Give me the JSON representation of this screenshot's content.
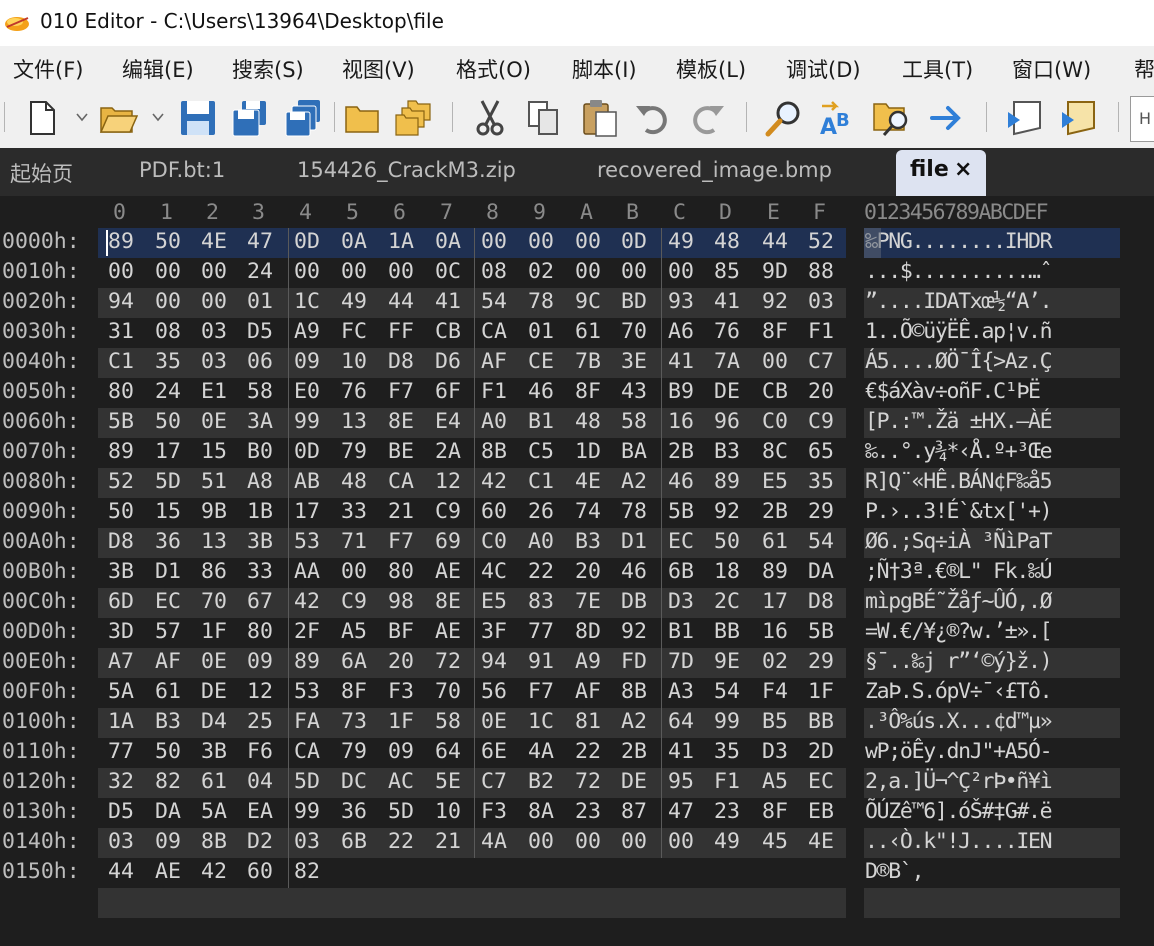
{
  "window": {
    "title": "010 Editor - C:\\Users\\13964\\Desktop\\file"
  },
  "menu": [
    "文件(F)",
    "编辑(E)",
    "搜索(S)",
    "视图(V)",
    "格式(O)",
    "脚本(I)",
    "模板(L)",
    "调试(D)",
    "工具(T)",
    "窗口(W)",
    "帮"
  ],
  "toolbar": {
    "icons": [
      "new-file-icon",
      "open-folder-icon",
      "save-icon",
      "save-as-icon",
      "save-all-icon",
      "folder-icon",
      "open-workspace-icon",
      "cut-icon",
      "copy-icon",
      "paste-icon",
      "undo-icon",
      "redo-icon",
      "find-icon",
      "replace-icon",
      "find-in-files-icon",
      "goto-icon",
      "run-script-icon",
      "run-template-icon"
    ],
    "overflow_label": "H"
  },
  "tabs": [
    "起始页",
    "PDF.bt:1",
    "154426_CrackM3.zip",
    "recovered_image.bmp",
    "file"
  ],
  "active_tab": {
    "label": "file",
    "close": "×"
  },
  "hex": {
    "columns": [
      "0",
      "1",
      "2",
      "3",
      "4",
      "5",
      "6",
      "7",
      "8",
      "9",
      "A",
      "B",
      "C",
      "D",
      "E",
      "F"
    ],
    "ascii_header": "0123456789ABCDEF",
    "rows": [
      {
        "offset": "0000h:",
        "bytes": [
          "89",
          "50",
          "4E",
          "47",
          "0D",
          "0A",
          "1A",
          "0A",
          "00",
          "00",
          "00",
          "0D",
          "49",
          "48",
          "44",
          "52"
        ],
        "ascii": "‰PNG........IHDR"
      },
      {
        "offset": "0010h:",
        "bytes": [
          "00",
          "00",
          "00",
          "24",
          "00",
          "00",
          "00",
          "0C",
          "08",
          "02",
          "00",
          "00",
          "00",
          "85",
          "9D",
          "88"
        ],
        "ascii": "...$..........…ˆ"
      },
      {
        "offset": "0020h:",
        "bytes": [
          "94",
          "00",
          "00",
          "01",
          "1C",
          "49",
          "44",
          "41",
          "54",
          "78",
          "9C",
          "BD",
          "93",
          "41",
          "92",
          "03"
        ],
        "ascii": "”....IDATxœ½“A’."
      },
      {
        "offset": "0030h:",
        "bytes": [
          "31",
          "08",
          "03",
          "D5",
          "A9",
          "FC",
          "FF",
          "CB",
          "CA",
          "01",
          "61",
          "70",
          "A6",
          "76",
          "8F",
          "F1"
        ],
        "ascii": "1..Õ©üÿËÊ.ap¦v.ñ"
      },
      {
        "offset": "0040h:",
        "bytes": [
          "C1",
          "35",
          "03",
          "06",
          "09",
          "10",
          "D8",
          "D6",
          "AF",
          "CE",
          "7B",
          "3E",
          "41",
          "7A",
          "00",
          "C7"
        ],
        "ascii": "Á5....ØÖ¯Î{>Az.Ç"
      },
      {
        "offset": "0050h:",
        "bytes": [
          "80",
          "24",
          "E1",
          "58",
          "E0",
          "76",
          "F7",
          "6F",
          "F1",
          "46",
          "8F",
          "43",
          "B9",
          "DE",
          "CB",
          "20"
        ],
        "ascii": "€$áXàv÷oñF.C¹ÞË "
      },
      {
        "offset": "0060h:",
        "bytes": [
          "5B",
          "50",
          "0E",
          "3A",
          "99",
          "13",
          "8E",
          "E4",
          "A0",
          "B1",
          "48",
          "58",
          "16",
          "96",
          "C0",
          "C9"
        ],
        "ascii": "[P.:™.Žä ±HX.–ÀÉ"
      },
      {
        "offset": "0070h:",
        "bytes": [
          "89",
          "17",
          "15",
          "B0",
          "0D",
          "79",
          "BE",
          "2A",
          "8B",
          "C5",
          "1D",
          "BA",
          "2B",
          "B3",
          "8C",
          "65"
        ],
        "ascii": "‰..°.y¾*‹Å.º+³Œe"
      },
      {
        "offset": "0080h:",
        "bytes": [
          "52",
          "5D",
          "51",
          "A8",
          "AB",
          "48",
          "CA",
          "12",
          "42",
          "C1",
          "4E",
          "A2",
          "46",
          "89",
          "E5",
          "35"
        ],
        "ascii": "R]Q¨«HÊ.BÁN¢F‰å5"
      },
      {
        "offset": "0090h:",
        "bytes": [
          "50",
          "15",
          "9B",
          "1B",
          "17",
          "33",
          "21",
          "C9",
          "60",
          "26",
          "74",
          "78",
          "5B",
          "92",
          "2B",
          "29"
        ],
        "ascii": "P.›..3!É`&tx['+)"
      },
      {
        "offset": "00A0h:",
        "bytes": [
          "D8",
          "36",
          "13",
          "3B",
          "53",
          "71",
          "F7",
          "69",
          "C0",
          "A0",
          "B3",
          "D1",
          "EC",
          "50",
          "61",
          "54"
        ],
        "ascii": "Ø6.;Sq÷iÀ ³ÑìPaT"
      },
      {
        "offset": "00B0h:",
        "bytes": [
          "3B",
          "D1",
          "86",
          "33",
          "AA",
          "00",
          "80",
          "AE",
          "4C",
          "22",
          "20",
          "46",
          "6B",
          "18",
          "89",
          "DA"
        ],
        "ascii": ";Ñ†3ª.€®L\" Fk.‰Ú"
      },
      {
        "offset": "00C0h:",
        "bytes": [
          "6D",
          "EC",
          "70",
          "67",
          "42",
          "C9",
          "98",
          "8E",
          "E5",
          "83",
          "7E",
          "DB",
          "D3",
          "2C",
          "17",
          "D8"
        ],
        "ascii": "mìpgBÉ˜Žåƒ~ÛÓ,.Ø"
      },
      {
        "offset": "00D0h:",
        "bytes": [
          "3D",
          "57",
          "1F",
          "80",
          "2F",
          "A5",
          "BF",
          "AE",
          "3F",
          "77",
          "8D",
          "92",
          "B1",
          "BB",
          "16",
          "5B"
        ],
        "ascii": "=W.€/¥¿®?w.’±».["
      },
      {
        "offset": "00E0h:",
        "bytes": [
          "A7",
          "AF",
          "0E",
          "09",
          "89",
          "6A",
          "20",
          "72",
          "94",
          "91",
          "A9",
          "FD",
          "7D",
          "9E",
          "02",
          "29"
        ],
        "ascii": "§¯..‰j r”‘©ý}ž.)"
      },
      {
        "offset": "00F0h:",
        "bytes": [
          "5A",
          "61",
          "DE",
          "12",
          "53",
          "8F",
          "F3",
          "70",
          "56",
          "F7",
          "AF",
          "8B",
          "A3",
          "54",
          "F4",
          "1F"
        ],
        "ascii": "ZaÞ.S.ópV÷¯‹£Tô."
      },
      {
        "offset": "0100h:",
        "bytes": [
          "1A",
          "B3",
          "D4",
          "25",
          "FA",
          "73",
          "1F",
          "58",
          "0E",
          "1C",
          "81",
          "A2",
          "64",
          "99",
          "B5",
          "BB"
        ],
        "ascii": ".³Ô%ús.X...¢d™µ»"
      },
      {
        "offset": "0110h:",
        "bytes": [
          "77",
          "50",
          "3B",
          "F6",
          "CA",
          "79",
          "09",
          "64",
          "6E",
          "4A",
          "22",
          "2B",
          "41",
          "35",
          "D3",
          "2D"
        ],
        "ascii": "wP;öÊy.dnJ\"+A5Ó-"
      },
      {
        "offset": "0120h:",
        "bytes": [
          "32",
          "82",
          "61",
          "04",
          "5D",
          "DC",
          "AC",
          "5E",
          "C7",
          "B2",
          "72",
          "DE",
          "95",
          "F1",
          "A5",
          "EC"
        ],
        "ascii": "2‚a.]Ü¬^Ç²rÞ•ñ¥ì"
      },
      {
        "offset": "0130h:",
        "bytes": [
          "D5",
          "DA",
          "5A",
          "EA",
          "99",
          "36",
          "5D",
          "10",
          "F3",
          "8A",
          "23",
          "87",
          "47",
          "23",
          "8F",
          "EB"
        ],
        "ascii": "ÕÚZê™6].óŠ#‡G#.ë"
      },
      {
        "offset": "0140h:",
        "bytes": [
          "03",
          "09",
          "8B",
          "D2",
          "03",
          "6B",
          "22",
          "21",
          "4A",
          "00",
          "00",
          "00",
          "00",
          "49",
          "45",
          "4E"
        ],
        "ascii": "..‹Ò.k\"!J....IEN"
      },
      {
        "offset": "0150h:",
        "bytes": [
          "44",
          "AE",
          "42",
          "60",
          "82"
        ],
        "ascii": "D®B`‚"
      }
    ]
  },
  "colors": {
    "background": "#1e1e1e",
    "band": "#333333",
    "selected_row": "#1f3052",
    "active_tab": "#dde3f1",
    "text": "#d4d4d4"
  }
}
